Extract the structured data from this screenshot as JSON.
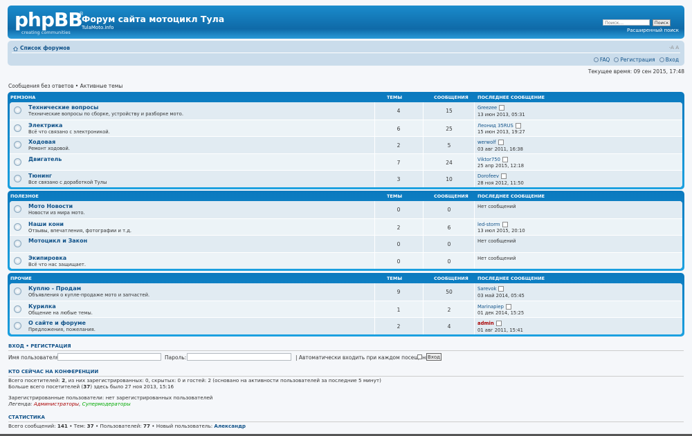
{
  "header": {
    "logo_text": "phpBB",
    "logo_reg": "®",
    "logo_sub": "creating communities",
    "site_title": "Форум сайта мотоцикл Тула",
    "site_desc": "TulaMoto.info",
    "search_placeholder": "Поиск…",
    "search_button": "Поиск",
    "advanced_search": "Расширенный поиск"
  },
  "navbar": {
    "forum_list": "Список форумов",
    "font_size": "-A A",
    "faq": "FAQ",
    "register": "Регистрация",
    "login": "Вход"
  },
  "current_time": "Текущее время: 09 сен 2015, 17:48",
  "quicklinks": "Сообщения без ответов • Активные темы",
  "columns": {
    "topics": "ТЕМЫ",
    "posts": "СООБЩЕНИЯ",
    "last_post": "ПОСЛЕДНЕЕ СООБЩЕНИЕ"
  },
  "categories": [
    {
      "name": "РЕМЗОНА",
      "forums": [
        {
          "title": "Технические вопросы",
          "desc": "Технические вопросы по сборке, устройству и разборке мото.",
          "topics": "4",
          "posts": "15",
          "last_author": "Greezee",
          "last_date": "13 июн 2013, 05:31",
          "admin": false
        },
        {
          "title": "Электрика",
          "desc": "Всё что связано с электроникой.",
          "topics": "6",
          "posts": "25",
          "last_author": "Леонид 35RUS",
          "last_date": "15 июн 2013, 19:27",
          "admin": false
        },
        {
          "title": "Ходовая",
          "desc": "Ремонт ходовой.",
          "topics": "2",
          "posts": "5",
          "last_author": "werwolf",
          "last_date": "03 авг 2011, 16:38",
          "admin": false
        },
        {
          "title": "Двигатель",
          "desc": "",
          "topics": "7",
          "posts": "24",
          "last_author": "Viktor750",
          "last_date": "25 апр 2015, 12:18",
          "admin": false
        },
        {
          "title": "Тюнинг",
          "desc": "Все связано с доработкой Тулы",
          "topics": "3",
          "posts": "10",
          "last_author": "Dorofeev",
          "last_date": "28 ноя 2012, 11:50",
          "admin": false
        }
      ]
    },
    {
      "name": "ПОЛЕЗНОЕ",
      "forums": [
        {
          "title": "Мото Новости",
          "desc": "Новости из мира мото.",
          "topics": "0",
          "posts": "0",
          "last_author": "Нет сообщений",
          "last_date": "",
          "admin": false,
          "none": true
        },
        {
          "title": "Наши кони",
          "desc": "Отзывы, впечатления, фотографии и т.д.",
          "topics": "2",
          "posts": "6",
          "last_author": "led-storm",
          "last_date": "13 июл 2015, 20:10",
          "admin": false
        },
        {
          "title": "Мотоцикл и Закон",
          "desc": "",
          "topics": "0",
          "posts": "0",
          "last_author": "Нет сообщений",
          "last_date": "",
          "admin": false,
          "none": true
        },
        {
          "title": "Экипировка",
          "desc": "Всё что нас защищает.",
          "topics": "0",
          "posts": "0",
          "last_author": "Нет сообщений",
          "last_date": "",
          "admin": false,
          "none": true
        }
      ]
    },
    {
      "name": "ПРОЧИЕ",
      "forums": [
        {
          "title": "Куплю - Продам",
          "desc": "Объявления о купле-продаже мото и запчастей.",
          "topics": "9",
          "posts": "50",
          "last_author": "Sarevok",
          "last_date": "03 май 2014, 05:45",
          "admin": false
        },
        {
          "title": "Курилка",
          "desc": "Общение на любые темы.",
          "topics": "1",
          "posts": "2",
          "last_author": "Marinapiep",
          "last_date": "01 дек 2014, 15:25",
          "admin": false
        },
        {
          "title": "О сайте и форуме",
          "desc": "Предложения, пожелания.",
          "topics": "2",
          "posts": "4",
          "last_author": "admin",
          "last_date": "01 авг 2011, 15:41",
          "admin": true
        }
      ]
    }
  ],
  "login": {
    "title": "ВХОД • РЕГИСТРАЦИЯ",
    "username_label": "Имя пользователя:",
    "password_label": "Пароль:",
    "auto_login": "| Автоматически входить при каждом посещении",
    "button": "Вход"
  },
  "online": {
    "title": "КТО СЕЙЧАС НА КОНФЕРЕНЦИИ",
    "line1_a": "Всего посетителей: ",
    "line1_b": "2",
    "line1_c": ", из них зарегистрированных: 0, скрытых: 0 и гостей: 2 (основано на активности пользователей за последние 5 минут)",
    "line2_a": "Больше всего посетителей (",
    "line2_b": "37",
    "line2_c": ") здесь было 27 ноя 2013, 15:16",
    "line3": "Зарегистрированные пользователи: нет зарегистрированных пользователей",
    "legend_label": "Легенда: ",
    "legend_admins": "Администраторы",
    "legend_sep": ", ",
    "legend_supermods": "Супермодераторы"
  },
  "stats": {
    "title": "СТАТИСТИКА",
    "posts_label": "Всего сообщений: ",
    "posts": "141",
    "topics_label": " • Тем: ",
    "topics": "37",
    "users_label": " • Пользователей: ",
    "users": "77",
    "newest_label": " • Новый пользователь: ",
    "newest": "Александр"
  },
  "colors": {
    "header_blue": "#0f6aa8",
    "link": "#105289",
    "admin_red": "#aa0000",
    "supermod_green": "#00aa00"
  }
}
